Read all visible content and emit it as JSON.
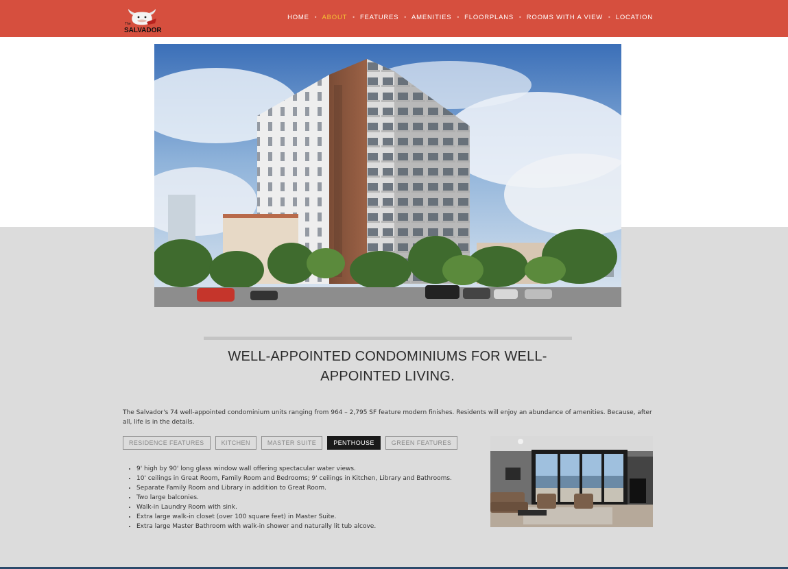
{
  "logo": {
    "line1": "The",
    "line2": "SALVADOR"
  },
  "nav": {
    "items": [
      {
        "label": "HOME",
        "active": false
      },
      {
        "label": "ABOUT",
        "active": true
      },
      {
        "label": "FEATURES",
        "active": false
      },
      {
        "label": "AMENITIES",
        "active": false
      },
      {
        "label": "FLOORPLANS",
        "active": false
      },
      {
        "label": "ROOMS WITH A VIEW",
        "active": false
      },
      {
        "label": "LOCATION",
        "active": false
      }
    ],
    "separator": "•"
  },
  "main": {
    "headline": "WELL-APPOINTED CONDOMINIUMS FOR WELL-APPOINTED LIVING.",
    "intro": "The Salvador's 74 well-appointed condominium units ranging from 964 – 2,795 SF feature modern finishes. Residents will enjoy an abundance of amenities. Because, after all, life is in the details.",
    "tabs": [
      {
        "label": "RESIDENCE FEATURES",
        "active": false
      },
      {
        "label": "KITCHEN",
        "active": false
      },
      {
        "label": "MASTER SUITE",
        "active": false
      },
      {
        "label": "PENTHOUSE",
        "active": true
      },
      {
        "label": "GREEN FEATURES",
        "active": false
      }
    ],
    "features": [
      "9' high by 90' long glass window wall offering spectacular water views.",
      "10' ceilings in Great Room, Family Room and Bedrooms; 9' ceilings in Kitchen, Library and Bathrooms.",
      "Separate Family Room and Library in addition to Great Room.",
      "Two large balconies.",
      "Walk-in Laundry Room with sink.",
      "Extra large walk-in closet (over 100 square feet) in Master Suite.",
      "Extra large Master Bathroom with walk-in shower and naturally lit tub alcove."
    ]
  },
  "colors": {
    "header": "#d64f3e",
    "nav_active": "#f5c234",
    "tab_active_bg": "#1a1a1a",
    "section_bg": "#dcdcdc"
  }
}
